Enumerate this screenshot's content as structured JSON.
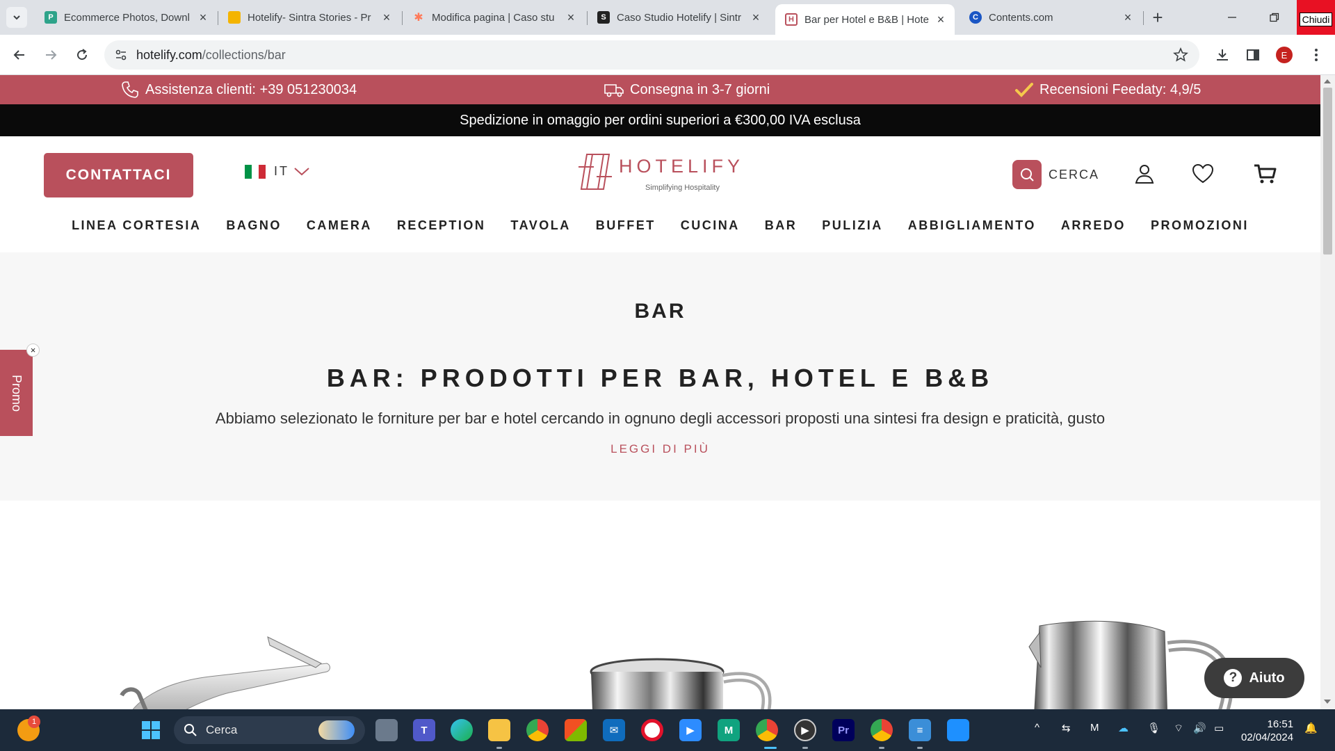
{
  "browser": {
    "tabs": [
      {
        "title": "Ecommerce Photos, Downl",
        "color": "#2ea38a",
        "glyph": "P"
      },
      {
        "title": "Hotelify- Sintra Stories - Pr",
        "color": "#f4b400",
        "glyph": ""
      },
      {
        "title": "Modifica pagina | Caso stu",
        "color": "#ff7a59",
        "glyph": "✱"
      },
      {
        "title": "Caso Studio Hotelify | Sintr",
        "color": "#222222",
        "glyph": "S"
      },
      {
        "title": "Bar per Hotel e B&B | Hote",
        "color": "#b9505c",
        "glyph": "H"
      },
      {
        "title": "Contents.com",
        "color": "#1a56c4",
        "glyph": "C"
      }
    ],
    "url_host": "hotelify.com",
    "url_path": "/collections/bar",
    "close_tooltip": "Chiudi",
    "profile_initial": "E"
  },
  "topbar": {
    "support": "Assistenza clienti: +39 051230034",
    "delivery": "Consegna in 3-7 giorni",
    "reviews": "Recensioni Feedaty: 4,9/5"
  },
  "shipping": "Spedizione in omaggio per ordini superiori a €300,00 IVA esclusa",
  "header": {
    "contact": "CONTATTACI",
    "lang": "IT",
    "logo_name": "HOTELIFY",
    "logo_tag": "Simplifying Hospitality",
    "search": "CERCA"
  },
  "nav": [
    "LINEA CORTESIA",
    "BAGNO",
    "CAMERA",
    "RECEPTION",
    "TAVOLA",
    "BUFFET",
    "CUCINA",
    "BAR",
    "PULIZIA",
    "ABBIGLIAMENTO",
    "ARREDO",
    "PROMOZIONI"
  ],
  "collection": {
    "title": "BAR",
    "heading": "BAR: PRODOTTI PER BAR, HOTEL E B&B",
    "description": "Abbiamo selezionato le forniture per bar e hotel cercando in ognuno degli accessori proposti una sintesi fra design e praticità, gusto",
    "read_more": "LEGGI DI PIÙ"
  },
  "promo_tab": "Promo",
  "help": "Aiuto",
  "taskbar": {
    "search": "Cerca",
    "time": "16:51",
    "date": "02/04/2024",
    "notification_count": "1"
  },
  "colors": {
    "brand": "#b9505c",
    "black_bar": "#0a0a0a",
    "taskbar": "#1c2a3a"
  }
}
